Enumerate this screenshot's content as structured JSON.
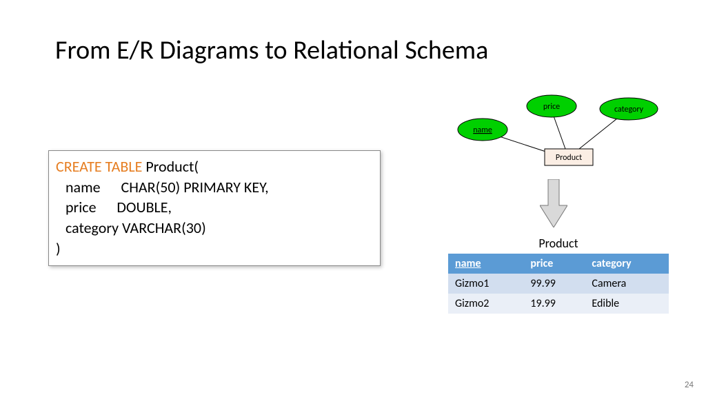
{
  "title": "From E/R Diagrams to Relational Schema",
  "sql": {
    "kw": "CREATE TABLE",
    "entity": "Product(",
    "line_name": "name      CHAR(50) PRIMARY KEY,",
    "line_price": "price      DOUBLE,",
    "line_category": "category VARCHAR(30)",
    "close": ")"
  },
  "er": {
    "entity": "Product",
    "attrs": {
      "name": "name",
      "price": "price",
      "category": "category"
    }
  },
  "table": {
    "caption": "Product",
    "headers": {
      "name": "name",
      "price": "price",
      "category": "category"
    },
    "rows": [
      {
        "name": "Gizmo1",
        "price": "99.99",
        "category": "Camera"
      },
      {
        "name": "Gizmo2",
        "price": "19.99",
        "category": "Edible"
      }
    ]
  },
  "page_number": "24"
}
